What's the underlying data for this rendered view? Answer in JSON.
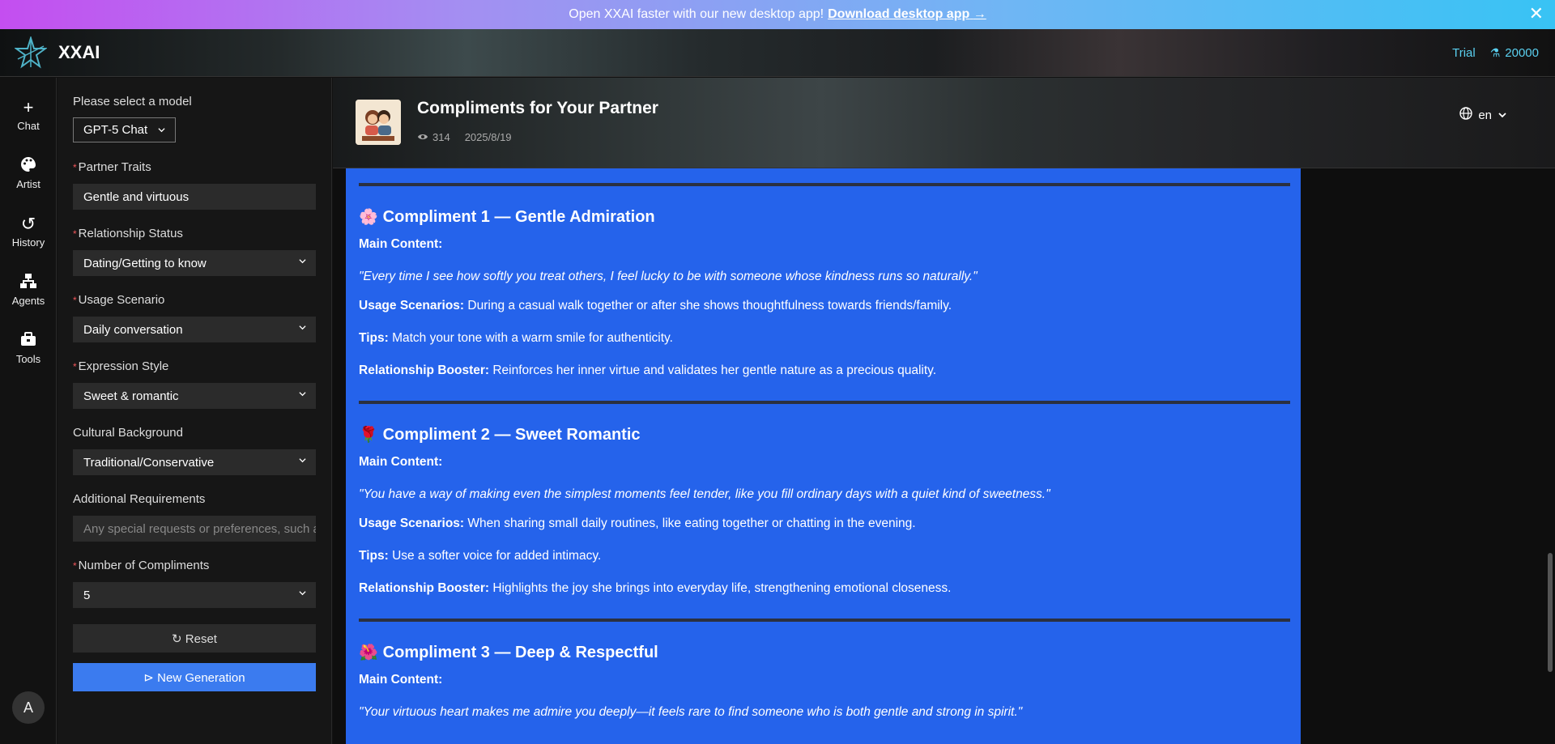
{
  "banner": {
    "text": "Open XXAI faster with our new desktop app!",
    "link": "Download desktop app",
    "arrow": "→",
    "close": "✕"
  },
  "header": {
    "brand": "XXAI",
    "plan": "Trial",
    "credits": "20000"
  },
  "nav": {
    "items": [
      {
        "label": "Chat",
        "icon": "+"
      },
      {
        "label": "Artist",
        "icon": "🎨"
      },
      {
        "label": "History",
        "icon": "↺"
      },
      {
        "label": "Agents",
        "icon": "☷"
      },
      {
        "label": "Tools",
        "icon": "▣"
      }
    ],
    "avatar": "A"
  },
  "form": {
    "model_label": "Please select a model",
    "model_value": "GPT-5 Chat",
    "fields": [
      {
        "label": "Partner Traits",
        "required": "*",
        "value": "Gentle and virtuous"
      },
      {
        "label": "Relationship Status",
        "required": "*",
        "value": "Dating/Getting to know"
      },
      {
        "label": "Usage Scenario",
        "required": "*",
        "value": "Daily conversation"
      },
      {
        "label": "Expression Style",
        "required": "*",
        "value": "Sweet & romantic"
      },
      {
        "label": "Cultural Background",
        "value": "Traditional/Conservative"
      },
      {
        "label": "Additional Requirements",
        "placeholder": "Any special requests or preferences, such as"
      },
      {
        "label": "Number of Compliments",
        "required": "*",
        "value": "5"
      }
    ],
    "reset": "↻ Reset",
    "new_generation": "⊳ New Generation"
  },
  "main": {
    "title": "Compliments for Your Partner",
    "views": "314",
    "date": "2025/8/19",
    "lang": "en",
    "compliments": [
      {
        "emoji": "🌸",
        "title": "Compliment 1 — Gentle Admiration",
        "main_label": "Main Content:",
        "quote": "\"Every time I see how softly you treat others, I feel lucky to be with someone whose kindness runs so naturally.\"",
        "usage_label": "Usage Scenarios:",
        "usage": "During a casual walk together or after she shows thoughtfulness towards friends/family.",
        "tips_label": "Tips:",
        "tips": "Match your tone with a warm smile for authenticity.",
        "booster_label": "Relationship Booster:",
        "booster": "Reinforces her inner virtue and validates her gentle nature as a precious quality."
      },
      {
        "emoji": "🌹",
        "title": "Compliment 2 — Sweet Romantic",
        "main_label": "Main Content:",
        "quote": "\"You have a way of making even the simplest moments feel tender, like you fill ordinary days with a quiet kind of sweetness.\"",
        "usage_label": "Usage Scenarios:",
        "usage": "When sharing small daily routines, like eating together or chatting in the evening.",
        "tips_label": "Tips:",
        "tips": "Use a softer voice for added intimacy.",
        "booster_label": "Relationship Booster:",
        "booster": "Highlights the joy she brings into everyday life, strengthening emotional closeness."
      },
      {
        "emoji": "🌺",
        "title": "Compliment 3 — Deep & Respectful",
        "main_label": "Main Content:",
        "quote": "\"Your virtuous heart makes me admire you deeply—it feels rare to find someone who is both gentle and strong in spirit.\""
      }
    ]
  }
}
